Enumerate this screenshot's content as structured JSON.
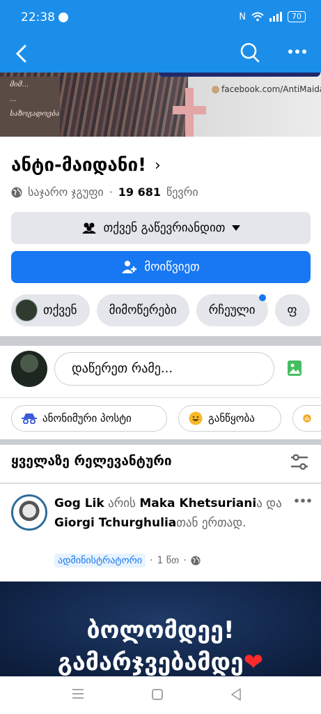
{
  "status_bar": {
    "time": "22:38",
    "battery": "70"
  },
  "cover": {
    "paper_lines": [
      "მიმ...",
      "...",
      "საზოგადოება"
    ],
    "watermark": "facebook.com/AntiMaidani"
  },
  "group": {
    "name": "ანტი-მაიდანი!",
    "privacy": "საჯარო ჯგუფი",
    "member_count": "19 681",
    "members_label": "წევრი"
  },
  "buttons": {
    "joined": "თქვენ გაწევრიანდით",
    "invite": "მოიწვიეთ"
  },
  "chips": [
    "თქვენ",
    "მიმოწერები",
    "რჩეული",
    "ფ"
  ],
  "composer": {
    "placeholder": "დაწერეთ რამე..."
  },
  "post_actions": [
    "ანონიმური პოსტი",
    "განწყობა",
    "..."
  ],
  "sort_label": "ყველაზე რელევანტური",
  "post": {
    "author": "Gog Lik",
    "is_with": "არის",
    "tag1": "Maka Khetsuriani",
    "tag1_suffix": "ა",
    "and": "და",
    "tag2": "Giorgi Tchurghulia",
    "tag2_suffix": "თან",
    "together": "ერთად.",
    "role_badge": "ადმინისტრატორი",
    "time": "1 წთ",
    "image_line1": "ბოლომდეე!",
    "image_line2": "გამარჯვებამდე",
    "heart": "❤"
  }
}
